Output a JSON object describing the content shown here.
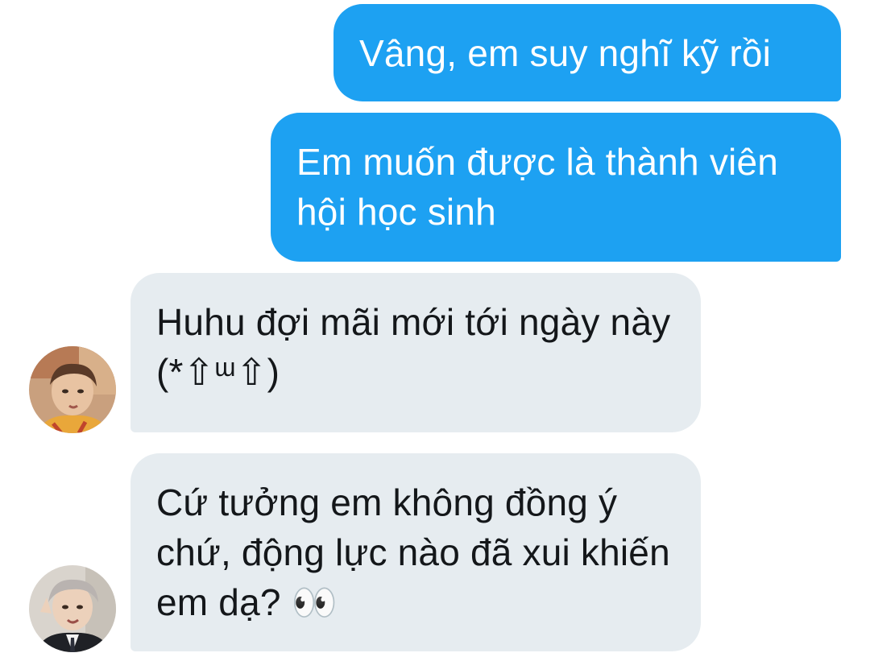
{
  "messages": [
    {
      "direction": "sent",
      "text": "Vâng, em suy nghĩ kỹ rồi"
    },
    {
      "direction": "sent",
      "text": "Em muốn được là thành viên hội học sinh"
    },
    {
      "direction": "received",
      "avatar": "avatar-warm-portrait",
      "text": "Huhu đợi mãi mới tới ngày này (*⇧ᵚ⇧)"
    },
    {
      "direction": "received",
      "avatar": "avatar-grey-portrait",
      "text": "Cứ tưởng em không đồng ý chứ, động lực nào đã xui khiến em dạ? 👀"
    }
  ],
  "colors": {
    "sent_bubble": "#1da1f2",
    "received_bubble": "#e6ecf0",
    "sent_text": "#ffffff",
    "received_text": "#14171a"
  }
}
